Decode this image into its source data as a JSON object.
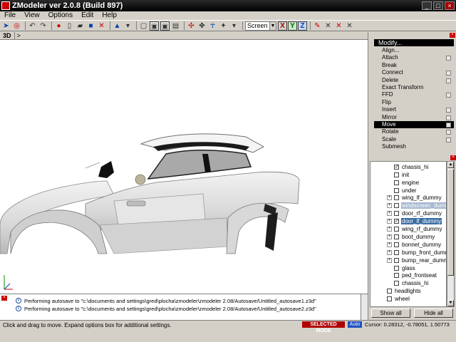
{
  "window": {
    "title": "ZModeler ver 2.0.8 (Build 897)",
    "controls": [
      "_",
      "□",
      "×"
    ]
  },
  "menu": [
    "File",
    "View",
    "Options",
    "Edit",
    "Help"
  ],
  "toolbar": {
    "view_mode": "Screen",
    "axes": [
      "X",
      "Y",
      "Z"
    ],
    "icons": [
      "select-arrow",
      "undo",
      "redo",
      "record",
      "new",
      "open",
      "save",
      "close",
      "color",
      "box",
      "box2",
      "box3",
      "box4",
      "manip",
      "walk",
      "person",
      "cam",
      "grid",
      "axis1",
      "axis2",
      "axis3"
    ]
  },
  "viewport": {
    "label": "3D",
    "expand": ">"
  },
  "modify": {
    "header": "Modify...",
    "items": [
      {
        "label": "Align...",
        "opt": false
      },
      {
        "label": "Attach",
        "opt": true
      },
      {
        "label": "Break",
        "opt": false
      },
      {
        "label": "Connect",
        "opt": true
      },
      {
        "label": "Delete",
        "opt": true
      },
      {
        "label": "Exact Transform",
        "opt": false
      },
      {
        "label": "FFD",
        "opt": true
      },
      {
        "label": "Flip",
        "opt": false
      },
      {
        "label": "Insert",
        "opt": true
      },
      {
        "label": "Mirror",
        "opt": true
      },
      {
        "label": "Move",
        "opt": true,
        "selected": true
      },
      {
        "label": "Rotate",
        "opt": true
      },
      {
        "label": "Scale",
        "opt": true
      },
      {
        "label": "Submesh",
        "opt": false
      }
    ]
  },
  "hierarchy": {
    "nodes": [
      {
        "label": "chassis_hi",
        "checked": true,
        "expander": false,
        "indent": 1,
        "state": ""
      },
      {
        "label": "init",
        "checked": false,
        "expander": false,
        "indent": 1,
        "state": ""
      },
      {
        "label": "engine",
        "checked": false,
        "expander": false,
        "indent": 1,
        "state": ""
      },
      {
        "label": "under",
        "checked": false,
        "expander": false,
        "indent": 1,
        "state": ""
      },
      {
        "label": "wing_lf_dummy",
        "checked": false,
        "expander": true,
        "indent": 1,
        "state": ""
      },
      {
        "label": "windscreen_dummy",
        "checked": false,
        "expander": true,
        "indent": 1,
        "state": "dim"
      },
      {
        "label": "door_rf_dummy",
        "checked": false,
        "expander": true,
        "indent": 1,
        "state": ""
      },
      {
        "label": "door_lf_dummy",
        "checked": true,
        "expander": true,
        "indent": 1,
        "state": "sel"
      },
      {
        "label": "wing_rf_dummy",
        "checked": false,
        "expander": true,
        "indent": 1,
        "state": ""
      },
      {
        "label": "boot_dummy",
        "checked": false,
        "expander": true,
        "indent": 1,
        "state": ""
      },
      {
        "label": "bonnet_dummy",
        "checked": false,
        "expander": true,
        "indent": 1,
        "state": ""
      },
      {
        "label": "bump_front_dummy",
        "checked": false,
        "expander": true,
        "indent": 1,
        "state": ""
      },
      {
        "label": "bump_rear_dummy",
        "checked": false,
        "expander": true,
        "indent": 1,
        "state": ""
      },
      {
        "label": "glass",
        "checked": false,
        "expander": false,
        "indent": 1,
        "state": ""
      },
      {
        "label": "ped_frontseat",
        "checked": false,
        "expander": false,
        "indent": 1,
        "state": ""
      },
      {
        "label": "chassis_hi",
        "checked": false,
        "expander": false,
        "indent": 1,
        "state": ""
      },
      {
        "label": "headlights",
        "checked": false,
        "expander": false,
        "indent": 0,
        "state": ""
      },
      {
        "label": "wheel",
        "checked": false,
        "expander": false,
        "indent": 0,
        "state": ""
      }
    ],
    "show_all": "Show all",
    "hide_all": "Hide all"
  },
  "log": [
    "Performing autosave to \"c:\\documents and settings\\gred\\plocha\\zmodeler\\zmodeler 2.08/Autosave/Untitled_autosave1.z3d\"",
    "Performing autosave to \"c:\\documents and settings\\gred\\plocha\\zmodeler\\zmodeler 2.08/Autosave/Untitled_autosave2.z3d\""
  ],
  "status": {
    "hint": "Click and drag to move. Expand options box for additional settings.",
    "mode": "SELECTED MODE",
    "auto": "Auto",
    "cursor": "Cursor: 0.28312, -0.78051, 1.50773"
  }
}
